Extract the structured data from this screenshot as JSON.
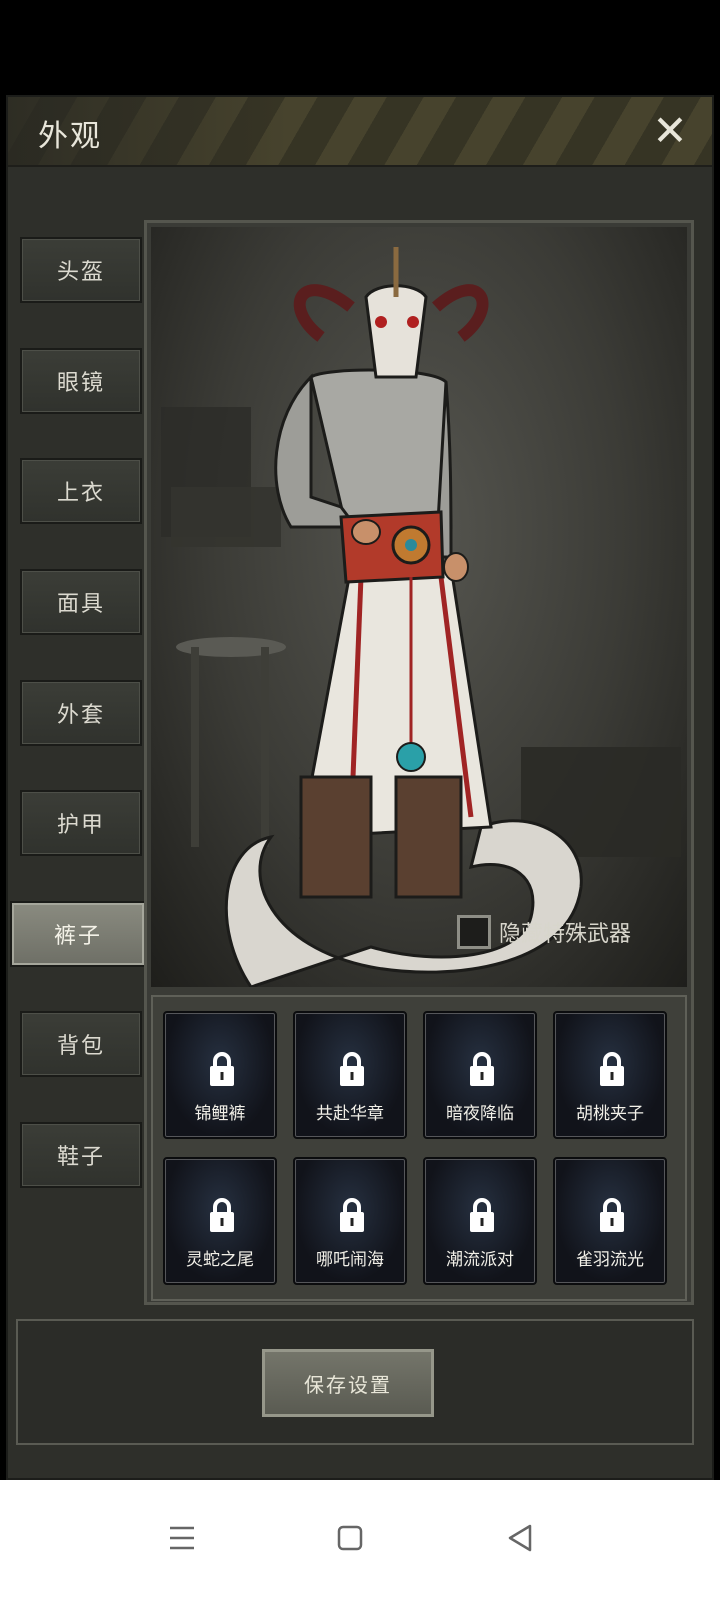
{
  "window": {
    "title": "外观",
    "close_icon": "close-icon"
  },
  "sidebar": {
    "items": [
      {
        "label": "头盔"
      },
      {
        "label": "眼镜"
      },
      {
        "label": "上衣"
      },
      {
        "label": "面具"
      },
      {
        "label": "外套"
      },
      {
        "label": "护甲"
      },
      {
        "label": "裤子",
        "active": true
      },
      {
        "label": "背包"
      },
      {
        "label": "鞋子"
      }
    ]
  },
  "preview": {
    "hide_weapon_label": "隐藏特殊武器",
    "hide_weapon_checked": false
  },
  "skins": [
    {
      "label": "锦鲤裤",
      "locked": true
    },
    {
      "label": "共赴华章",
      "locked": true
    },
    {
      "label": "暗夜降临",
      "locked": true
    },
    {
      "label": "胡桃夹子",
      "locked": true
    },
    {
      "label": "灵蛇之尾",
      "locked": true
    },
    {
      "label": "哪吒闹海",
      "locked": true
    },
    {
      "label": "潮流派对",
      "locked": true
    },
    {
      "label": "雀羽流光",
      "locked": true
    }
  ],
  "footer": {
    "save_label": "保存设置"
  },
  "system_nav": {
    "menu_icon": "menu-icon",
    "home_icon": "home-icon",
    "back_icon": "back-icon"
  },
  "colors": {
    "panel": "#2e2f2a",
    "active_tab": "#7c7d73",
    "accent_red": "#a02424"
  }
}
